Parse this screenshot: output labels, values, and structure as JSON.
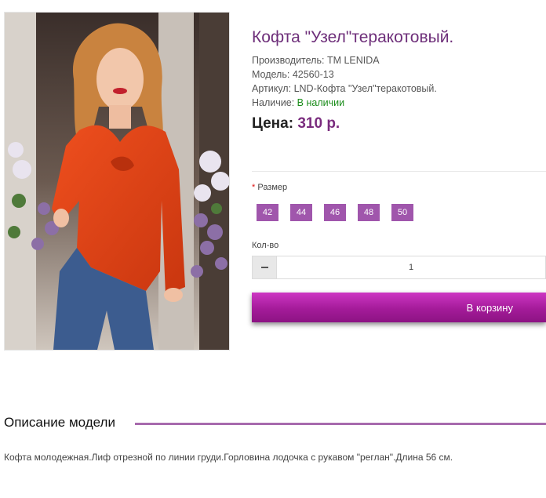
{
  "product": {
    "title": "Кофта \"Узел\"теракотовый.",
    "manufacturer_label": "Производитель:",
    "manufacturer": "TM LENIDA",
    "model_label": "Модель:",
    "model": "42560-13",
    "sku_label": "Артикул:",
    "sku": "LND-Кофта \"Узел\"теракотовый.",
    "availability_label": "Наличие:",
    "availability": "В наличии",
    "price_label": "Цена:",
    "price": "310 р."
  },
  "options": {
    "size_required_mark": "*",
    "size_label": "Размер",
    "sizes": [
      "42",
      "44",
      "46",
      "48",
      "50"
    ]
  },
  "quantity": {
    "label": "Кол-во",
    "value": "1"
  },
  "cart": {
    "button_label": "В корзину"
  },
  "description": {
    "heading": "Описание модели",
    "text": "Кофта молодежная.Лиф отрезной по линии груди.Горловина лодочка с рукавом \"реглан\".Длина 56 см."
  },
  "colors": {
    "accent": "#a056ac",
    "title": "#6e2f7a",
    "in_stock": "#1a8c1a",
    "button_top": "#cd36c3",
    "button_bottom": "#8c1383"
  }
}
